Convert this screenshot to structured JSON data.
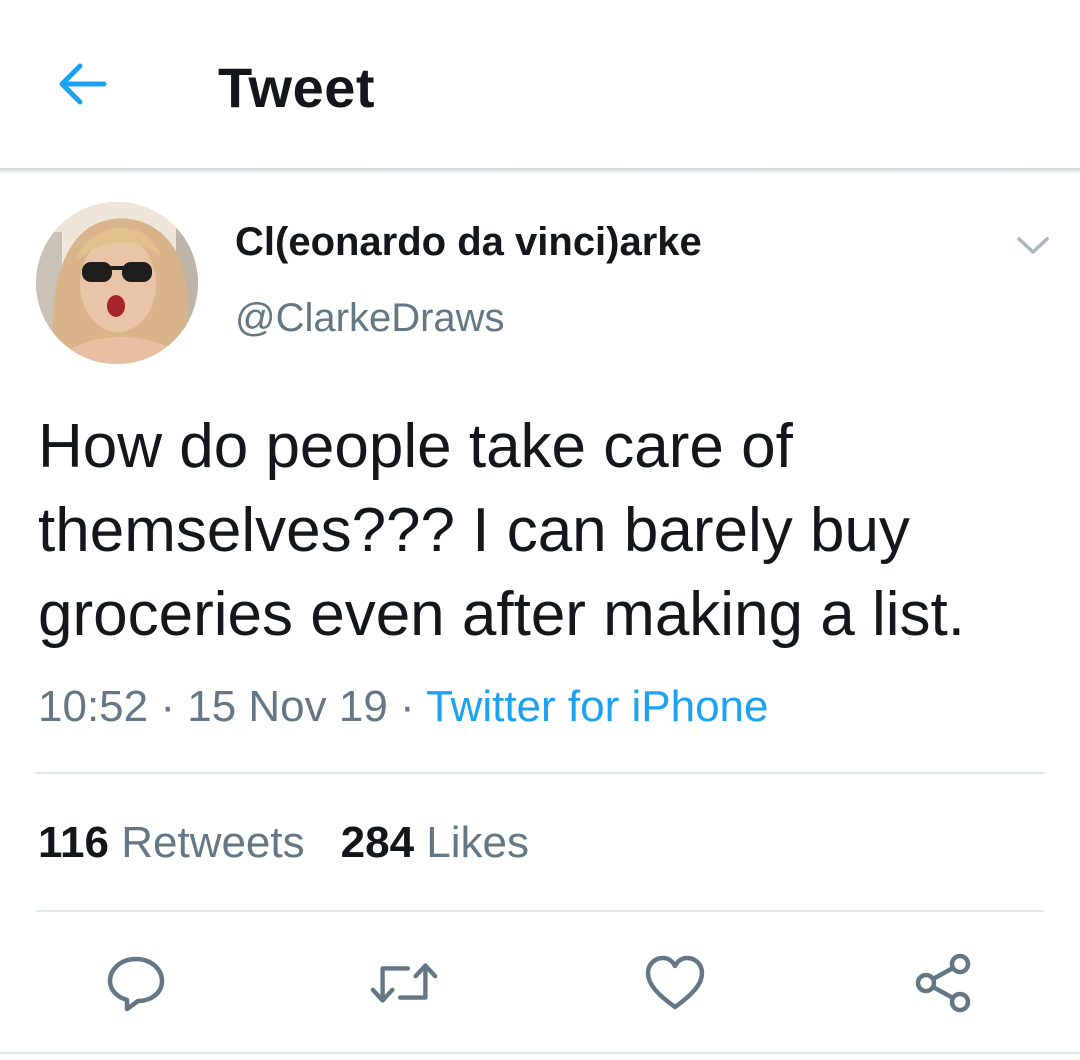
{
  "header": {
    "title": "Tweet",
    "back_icon": "back-arrow-icon",
    "accent": "#1da1f2"
  },
  "tweet": {
    "author": {
      "display_name": "Cl(eonardo da vinci)arke",
      "handle": "@ClarkeDraws"
    },
    "text": "How do people take care of\nthemselves??? I can barely buy\ngroceries even after making a list.",
    "time": "10:52",
    "date": "15 Nov 19",
    "separator": " · ",
    "source": "Twitter for iPhone",
    "stats": {
      "retweets_count": "116",
      "retweets_label": "Retweets",
      "likes_count": "284",
      "likes_label": "Likes"
    },
    "actions": [
      {
        "icon": "reply-icon"
      },
      {
        "icon": "retweet-icon"
      },
      {
        "icon": "like-icon"
      },
      {
        "icon": "share-icon"
      }
    ]
  },
  "colors": {
    "text_primary": "#14171a",
    "text_secondary": "#657786",
    "divider": "#e1e8ed",
    "link": "#1da1f2"
  }
}
